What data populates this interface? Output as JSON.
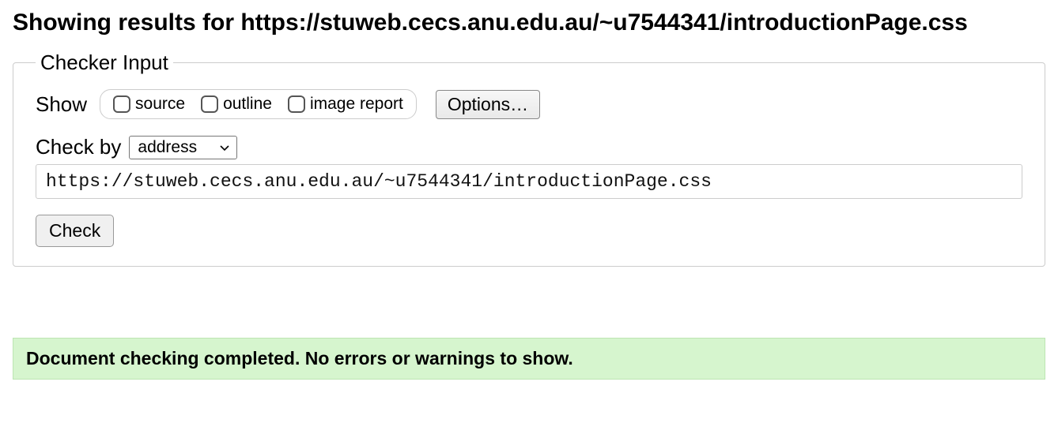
{
  "heading_prefix": "Showing results for ",
  "heading_url": "https://stuweb.cecs.anu.edu.au/~u7544341/introductionPage.css",
  "legend": "Checker Input",
  "show": {
    "label": "Show",
    "options": {
      "source": "source",
      "outline": "outline",
      "image_report": "image report"
    },
    "options_button": "Options…"
  },
  "checkby": {
    "label": "Check by",
    "selected": "address"
  },
  "url_value": "https://stuweb.cecs.anu.edu.au/~u7544341/introductionPage.css",
  "check_button": "Check",
  "result_message": "Document checking completed. No errors or warnings to show."
}
